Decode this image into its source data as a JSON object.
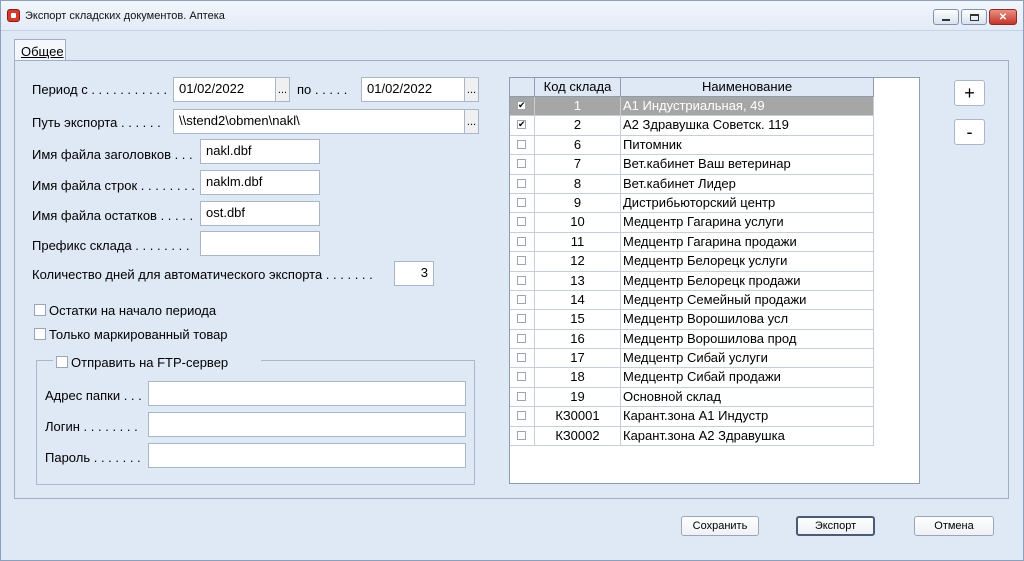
{
  "window": {
    "title": "Экспорт складских документов. Аптека",
    "minimize": "",
    "maximize": "",
    "close": "✕"
  },
  "tab": {
    "label": "Общее"
  },
  "form": {
    "period_from_label": "Период с . . . . . . . . . . .",
    "period_from_value": "01/02/2022",
    "period_to_label": "по . . . . .",
    "period_to_value": "01/02/2022",
    "path_label": "Путь экспорта . . . . . .",
    "path_value": "\\\\stend2\\obmen\\nakl\\",
    "ellipsis": "...",
    "header_file_label": "Имя файла заголовков . . .",
    "header_file_value": "nakl.dbf",
    "rows_file_label": "Имя файла строк . . . . . . . .",
    "rows_file_value": "naklm.dbf",
    "rest_file_label": "Имя файла остатков . . . . .",
    "rest_file_value": "ost.dbf",
    "prefix_label": "Префикс склада . . . . . . . .",
    "prefix_value": "",
    "days_label": "Количество дней для автоматического экспорта . . . . . . .",
    "days_value": "3",
    "opening_balance_label": "Остатки на начало периода",
    "marked_only_label": "Только маркированный товар"
  },
  "ftp": {
    "send_label": "Отправить на FTP-сервер",
    "folder_label": "Адрес папки . . .",
    "folder_value": "",
    "login_label": "Логин . . . . . . . .",
    "login_value": "",
    "password_label": "Пароль . . . . . . .",
    "password_value": ""
  },
  "grid": {
    "col_code": "Код склада",
    "col_name": "Наименование",
    "rows": [
      {
        "checked": true,
        "code": "1",
        "name": "А1 Индустриальная, 49",
        "selected": true
      },
      {
        "checked": true,
        "code": "2",
        "name": "А2 Здравушка Советск. 119"
      },
      {
        "checked": false,
        "code": "6",
        "name": "Питомник"
      },
      {
        "checked": false,
        "code": "7",
        "name": "Вет.кабинет Ваш ветеринар"
      },
      {
        "checked": false,
        "code": "8",
        "name": "Вет.кабинет Лидер"
      },
      {
        "checked": false,
        "code": "9",
        "name": "Дистрибьюторский центр"
      },
      {
        "checked": false,
        "code": "10",
        "name": "Медцентр Гагарина услуги"
      },
      {
        "checked": false,
        "code": "11",
        "name": "Медцентр Гагарина продажи"
      },
      {
        "checked": false,
        "code": "12",
        "name": "Медцентр Белорецк услуги"
      },
      {
        "checked": false,
        "code": "13",
        "name": "Медцентр Белорецк продажи"
      },
      {
        "checked": false,
        "code": "14",
        "name": "Медцентр Семейный продажи"
      },
      {
        "checked": false,
        "code": "15",
        "name": "Медцентр Ворошилова усл"
      },
      {
        "checked": false,
        "code": "16",
        "name": "Медцентр Ворошилова прод"
      },
      {
        "checked": false,
        "code": "17",
        "name": "Медцентр Сибай услуги"
      },
      {
        "checked": false,
        "code": "18",
        "name": "Медцентр Сибай продажи"
      },
      {
        "checked": false,
        "code": "19",
        "name": "Основной склад"
      },
      {
        "checked": false,
        "code": "КЗ0001",
        "name": "Карант.зона А1 Индустр"
      },
      {
        "checked": false,
        "code": "КЗ0002",
        "name": "Карант.зона А2 Здравушка"
      }
    ]
  },
  "side": {
    "add": "+",
    "remove": "-"
  },
  "buttons": {
    "save": "Сохранить",
    "export": "Экспорт",
    "cancel": "Отмена"
  }
}
